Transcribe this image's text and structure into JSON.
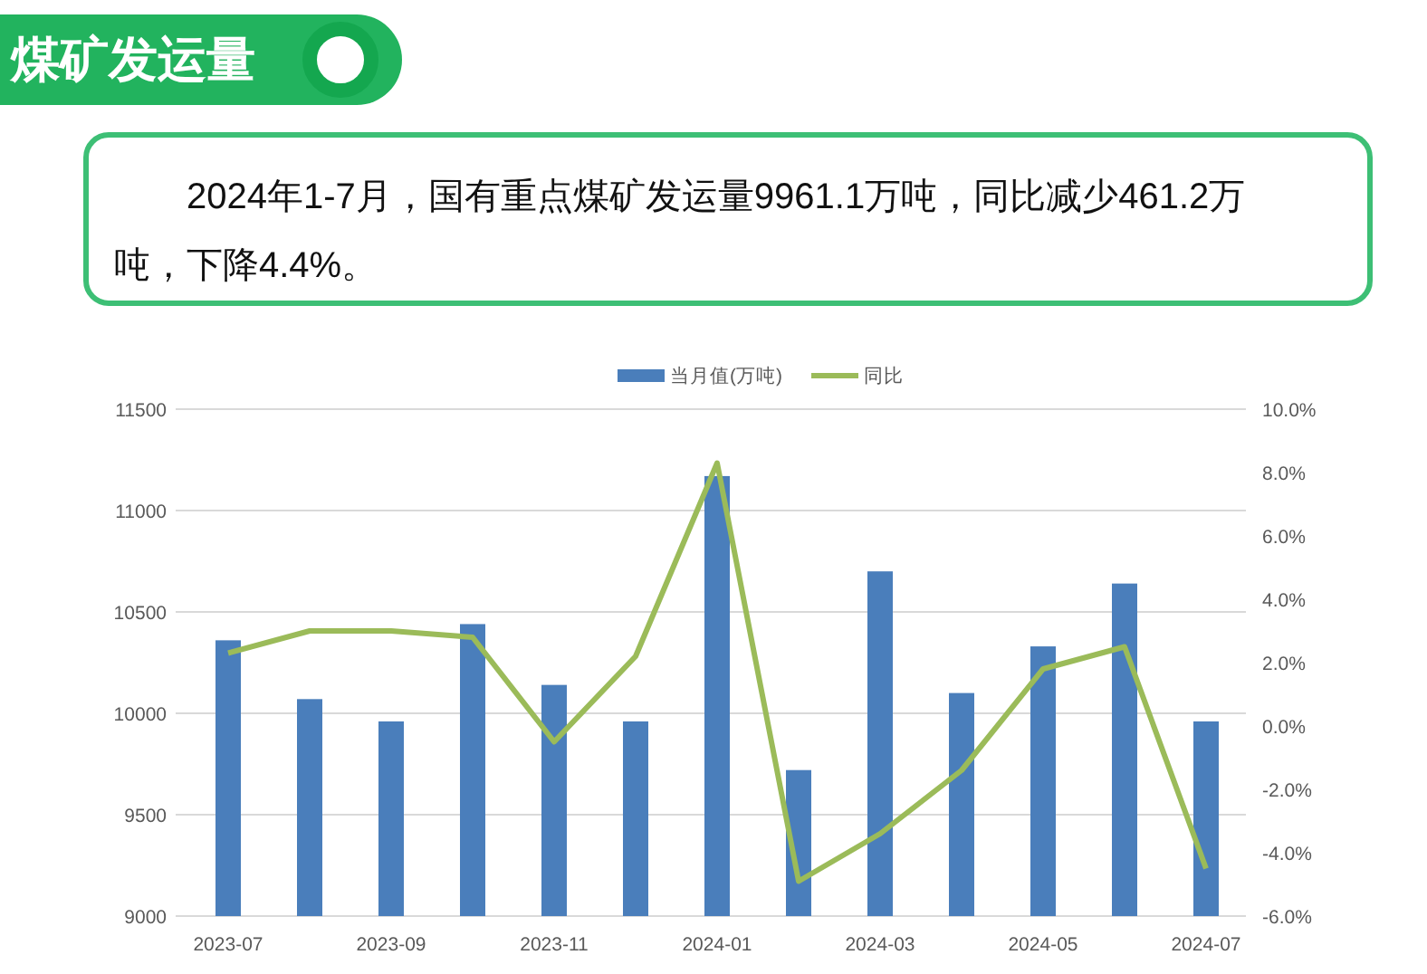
{
  "header": {
    "title": "煤矿发运量"
  },
  "summary": {
    "text": "2024年1-7月，国有重点煤矿发运量9961.1万吨，同比减少461.2万吨，下降4.4%。"
  },
  "chart": {
    "bars": {
      "chart_data": {
        "type": "bar",
        "categories": [
          "2023-07",
          null,
          "2023-09",
          null,
          "2023-11",
          null,
          "2024-01",
          null,
          "2024-03",
          null,
          "2024-05",
          null,
          "2024-07"
        ],
        "ylim": [
          9000,
          11500
        ],
        "grid": true,
        "yticks": [
          9000,
          9500,
          10000,
          10500,
          11000,
          11500
        ],
        "series": [
          {
            "name": "当月值(万吨)",
            "color": "#4a7ebb",
            "values": [
              10360,
              10070,
              9960,
              10440,
              10140,
              9960,
              11170,
              9720,
              10700,
              10100,
              10330,
              10640,
              9960
            ]
          }
        ]
      }
    },
    "line": {
      "chart_data": {
        "type": "line",
        "categories": [
          null,
          null,
          null,
          null,
          null,
          null,
          null,
          null,
          null,
          null,
          null,
          null,
          null
        ],
        "ylim": [
          -6,
          10
        ],
        "yticks": [
          {
            "value": -6,
            "label": "-6.0%"
          },
          {
            "value": -4,
            "label": "-4.0%"
          },
          {
            "value": -2,
            "label": "-2.0%"
          },
          {
            "value": 0,
            "label": "0.0%"
          },
          {
            "value": 2,
            "label": "2.0%"
          },
          {
            "value": 4,
            "label": "4.0%"
          },
          {
            "value": 6,
            "label": "6.0%"
          },
          {
            "value": 8,
            "label": "8.0%"
          },
          {
            "value": 10,
            "label": "10.0%"
          }
        ],
        "series": [
          {
            "name": "同比",
            "color": "#9bbb59",
            "values": [
              2.3,
              3.0,
              3.0,
              2.8,
              -0.5,
              2.2,
              8.3,
              -4.9,
              -3.4,
              -1.4,
              1.8,
              2.5,
              -4.5
            ]
          }
        ]
      }
    }
  }
}
